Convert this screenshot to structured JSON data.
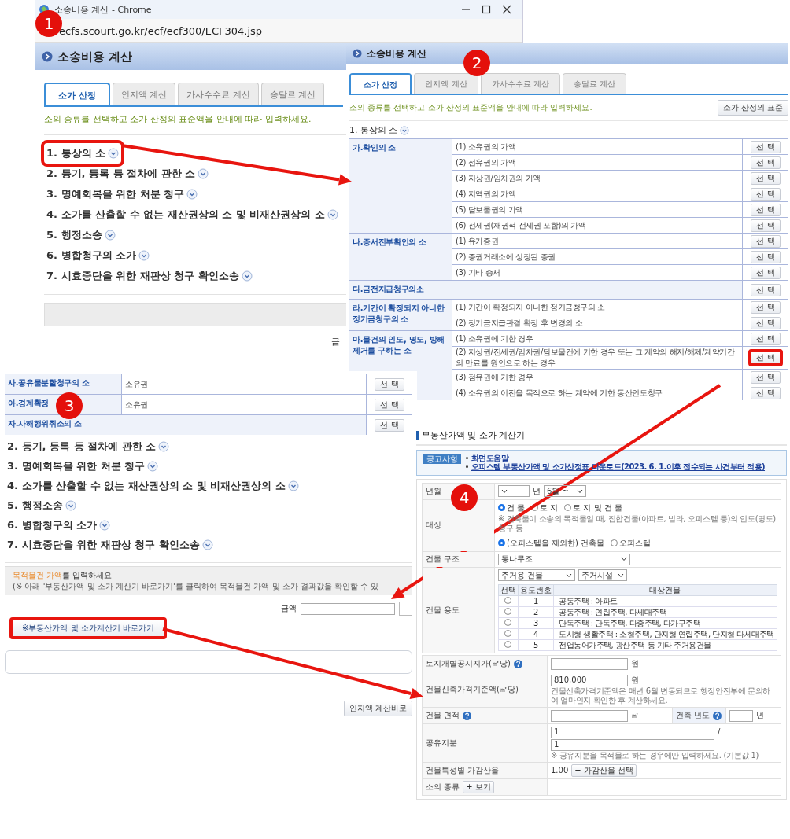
{
  "badges": [
    "1",
    "2",
    "3",
    "4"
  ],
  "panel1": {
    "window_title": "소송비용 계산 - Chrome",
    "address": "ecfs.scourt.go.kr/ecf/ecf300/ECF304.jsp",
    "header": "소송비용 계산",
    "tabs": [
      {
        "label": "소가 산정",
        "selected": true
      },
      {
        "label": "인지액 계산",
        "selected": false
      },
      {
        "label": "가사수수료 계산",
        "selected": false
      },
      {
        "label": "송달료 계산",
        "selected": false
      }
    ],
    "instruction": "소의 종류를 선택하고 소가 산정의 표준액을 안내에 따라 입력하세요.",
    "categories": [
      {
        "label": "1. 통상의 소",
        "highlighted": true
      },
      {
        "label": "2. 등기, 등록 등 절차에 관한 소",
        "highlighted": false
      },
      {
        "label": "3. 명예회복을 위한 처분 청구",
        "highlighted": false
      },
      {
        "label": "4. 소가를 산출할 수 없는 재산권상의 소 및 비재산권상의 소",
        "highlighted": false
      },
      {
        "label": "5. 행정소송",
        "highlighted": false
      },
      {
        "label": "6. 병합청구의 소가",
        "highlighted": false
      },
      {
        "label": "7. 시효중단을 위한 재판상 청구 확인소송",
        "highlighted": false
      }
    ],
    "amount_label": "금"
  },
  "panel2": {
    "header": "소송비용 계산",
    "tabs": [
      {
        "label": "소가 산정",
        "selected": true
      },
      {
        "label": "인지액 계산",
        "selected": false
      },
      {
        "label": "가사수수료 계산",
        "selected": false
      },
      {
        "label": "송달료 계산",
        "selected": false
      }
    ],
    "instruction": "소의 종류를 선택하고 소가 산정의 표준액을 안내에 따라 입력하세요.",
    "standard_button": "소가 산정의 표준",
    "section": "1. 통상의 소",
    "groups": [
      {
        "label": "가.확인의 소",
        "items": [
          {
            "text": "(1) 소유권의 가액",
            "button": "선 택",
            "highlighted": false
          },
          {
            "text": "(2) 점유권의 가액",
            "button": "선 택",
            "highlighted": false
          },
          {
            "text": "(3) 지상권/임차권의 가액",
            "button": "선 택",
            "highlighted": false
          },
          {
            "text": "(4) 지역권의 가액",
            "button": "선 택",
            "highlighted": false
          },
          {
            "text": "(5) 담보물권의 가액",
            "button": "선 택",
            "highlighted": false
          },
          {
            "text": "(6) 전세권(채권적 전세권 포함)의 가액",
            "button": "선 택",
            "highlighted": false
          }
        ]
      },
      {
        "label": "나.증서진부확인의 소",
        "items": [
          {
            "text": "(1) 유가증권",
            "button": "선 택",
            "highlighted": false
          },
          {
            "text": "(2) 증권거래소에 상장된 증권",
            "button": "선 택",
            "highlighted": false
          },
          {
            "text": "(3) 기타 증서",
            "button": "선 택",
            "highlighted": false
          }
        ]
      },
      {
        "label": "다.금전지급청구의소",
        "button": "선 택"
      },
      {
        "label": "라.기간이 확정되지 아니한 정기금청구의 소",
        "items": [
          {
            "text": "(1) 기간이 확정되지 아니한 정기금청구의 소",
            "button": "선 택",
            "highlighted": false
          },
          {
            "text": "(2) 정기금지급판결 확정 후 변경의 소",
            "button": "선 택",
            "highlighted": false
          }
        ]
      },
      {
        "label": "마.물건의 인도, 명도, 방해제거를 구하는 소",
        "items": [
          {
            "text": "(1) 소유권에 기한 경우",
            "button": "선 택",
            "highlighted": false
          },
          {
            "text": "(2) 지상권/전세권/임차권/담보물건에 기한 경우 또는 그 계약의 해지/해제/계약기간의 만료를 원인으로 하는 경우",
            "button": "선 택",
            "highlighted": true
          },
          {
            "text": "(3) 점유권에 기한 경우",
            "button": "선 택",
            "highlighted": false
          },
          {
            "text": "(4) 소유권의 이전을 목적으로 하는 계약에 기한 동산인도청구",
            "button": "선 택",
            "highlighted": false
          }
        ]
      }
    ]
  },
  "panel3": {
    "rows": [
      {
        "label": "사.공유물분할청구의 소",
        "value": "소유권",
        "button": "선 택"
      },
      {
        "label": "아.경계확정",
        "value": "소유권",
        "button": "선 택"
      },
      {
        "label": "자.사해행위취소의 소",
        "button": "선 택"
      }
    ],
    "categories": [
      "2. 등기, 등록 등 절차에 관한 소",
      "3. 명예회복을 위한 처분 청구",
      "4. 소가를 산출할 수 없는 재산권상의 소 및 비재산권상의 소",
      "5. 행정소송",
      "6. 병합청구의 소가",
      "7. 시효중단을 위한 재판상 청구 확인소송"
    ],
    "notice_highlight": "목적물건 가액",
    "notice_rest": "를 입력하세요",
    "notice_note": "(※ 아래 '부동산가액 및 소가 계산기 바로가기'를 클릭하여 목적물건 가액 및 소가 결과값을 확인할 수 있",
    "amount_label": "금액",
    "shortcut_button": {
      "label": "※부동산가액 및 소가계산기 바로가기",
      "highlighted": true
    },
    "stamp_button": "인지액 계산바로"
  },
  "panel4": {
    "title": "부동산가액 및 소가 계산기",
    "notice_label": "공고사항",
    "notice_links": [
      "화면도움말",
      "오피스텔 부동산가액 및 소가산정표 다운로드(2023. 6. 1.이후 접수되는 사건부터 적용)"
    ],
    "form": {
      "year_month": {
        "label": "년월",
        "year_unit": "년",
        "month": "6월 ~"
      },
      "target": {
        "label": "대상",
        "options": [
          {
            "label": "건 물",
            "selected": true
          },
          {
            "label": "토 지",
            "selected": false
          },
          {
            "label": "토 지 및 건 물",
            "selected": false
          }
        ],
        "note": "※ 건축물이 소송의 목적물일 때, 집합건물(아파트, 빌라, 오피스텔 등)의 인도(명도)청구 등",
        "building_options": [
          {
            "label": "(오피스텔을 제외한) 건축물",
            "selected": true
          },
          {
            "label": "오피스텔",
            "selected": false
          }
        ]
      },
      "structure": {
        "label": "건물 구조",
        "value": "통나무조"
      },
      "usage": {
        "label": "건물 용도",
        "category": "주거용 건물",
        "subcategory": "주거시설",
        "columns": [
          "선택",
          "용도번호",
          "대상건물"
        ],
        "rows": [
          {
            "number": "1",
            "description": "-공동주택 : 아파트",
            "selected": false
          },
          {
            "number": "2",
            "description": "-공동주택 : 연립주택, 다세대주택",
            "selected": false
          },
          {
            "number": "3",
            "description": "-단독주택 : 단독주택, 다중주택, 다가구주택",
            "selected": false
          },
          {
            "number": "4",
            "description": "-도시형 생활주택 : 소형주택, 단지형 연립주택, 단지형 다세대주택",
            "selected": false
          },
          {
            "number": "5",
            "description": "-전업농어가주택, 광산주택 등 기타 주거용건물",
            "selected": false
          }
        ]
      },
      "land_price": {
        "label": "토지개별공시지가(㎡당)",
        "unit": "원"
      },
      "building_price": {
        "label": "건물신축가격기준액(㎡당)",
        "value": "810,000",
        "unit": "원",
        "note": "건물신축가격기준액은 매년 6월 변동되므로 행정안전부에 문의하여 얼마인지 확인한 후 계산하세요."
      },
      "area": {
        "label": "건물 면적",
        "unit": "㎡",
        "year_label": "건축 년도",
        "year_unit": "년"
      },
      "share": {
        "label": "공유지분",
        "numerator": "1",
        "separator": "/",
        "denominator": "1",
        "note": "※ 공유지분을 목적물로 하는 경우에만 입력하세요. (기본값 1)"
      },
      "adjustment": {
        "label": "건물특성별 가감산율",
        "value": "1.00",
        "button": "+ 가감산율 선택"
      },
      "case_type": {
        "label": "소의 종류",
        "button": "+ 보기"
      }
    }
  }
}
